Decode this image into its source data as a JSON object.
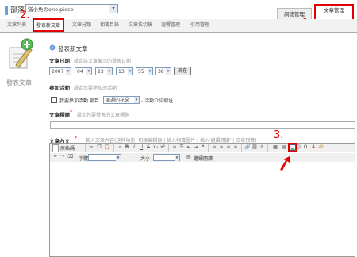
{
  "header": {
    "title": "部落",
    "blog_select": "猶小魚のone piece",
    "tabs": [
      {
        "label": "網誌管理",
        "active": false
      },
      {
        "label": "文章管理",
        "active": true
      }
    ],
    "annotation_1": "1."
  },
  "subnav": {
    "items": [
      {
        "label": "文章列表",
        "active": false
      },
      {
        "label": "發表新文章",
        "active": true
      },
      {
        "label": "文章分類",
        "active": false
      },
      {
        "label": "相簿目錄",
        "active": false
      },
      {
        "label": "文章拉切稿",
        "active": false
      },
      {
        "label": "迴響管理",
        "active": false
      },
      {
        "label": "引用管理",
        "active": false
      }
    ],
    "annotation_2": "2."
  },
  "sidebar": {
    "label": "發表文章"
  },
  "main": {
    "section_title": "發表新文章",
    "date": {
      "label": "文章日期",
      "hint": "設定該文章顯示的發表日期",
      "year": "2007",
      "month": "04",
      "day": "23",
      "hour": "13",
      "minute": "55",
      "second": "38",
      "now_button": "現在"
    },
    "event": {
      "label": "參加活動",
      "hint": "設定您要參加的活動",
      "checkbox_label": "我要參加活動 項目",
      "event_select": "溝通的花朵",
      "event_suffix": "- 活動介紹網址"
    },
    "post_title": {
      "label": "文章標題",
      "required_mark": "*",
      "hint": "設定您要發表的文章標題",
      "value": ""
    },
    "content": {
      "label": "文章內文",
      "required_mark": "*",
      "hint": "輸入文章內容(延伸功能: 切換編輯器 | 插入相簿圖片 | 插入'繼續閱讀' | 文章預覽)"
    },
    "editor": {
      "source_button": "原始碼",
      "font_label": "字體",
      "size_label": "大小",
      "continue_label": "繼續閱讀"
    },
    "annotation_3": "3."
  },
  "colors": {
    "highlight": "#e00000",
    "accent_blue": "#6aa0d8"
  }
}
